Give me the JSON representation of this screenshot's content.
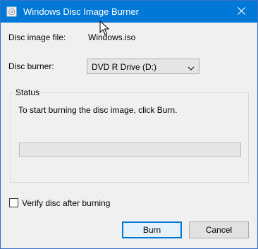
{
  "window": {
    "title": "Windows Disc Image Burner",
    "close_glyph": "✕"
  },
  "icons": {
    "app": "disc-burner-icon",
    "close": "close-icon",
    "dropdown": "chevron-down-icon",
    "cursor": "mouse-cursor-icon"
  },
  "fields": {
    "disc_image_label": "Disc image file:",
    "disc_image_value": "Windows.iso",
    "disc_burner_label": "Disc burner:",
    "disc_burner_selected": "DVD R Drive (D:)"
  },
  "status": {
    "group_title": "Status",
    "message": "To start burning the disc image, click Burn.",
    "progress_fraction": 0
  },
  "options": {
    "verify_label": "Verify disc after burning",
    "verify_checked": false
  },
  "buttons": {
    "burn": "Burn",
    "cancel": "Cancel"
  },
  "colors": {
    "titlebar": "#0078d7",
    "default_button_border": "#0078d7"
  }
}
